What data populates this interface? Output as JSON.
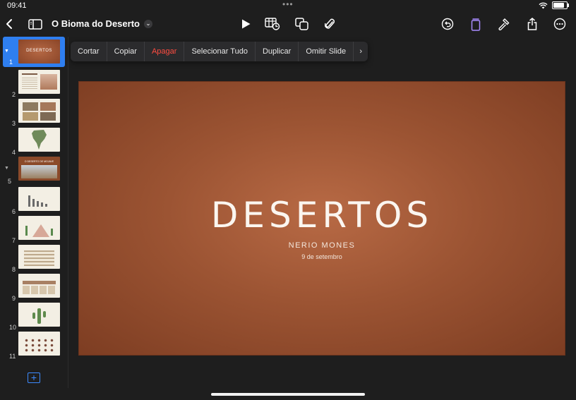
{
  "status": {
    "time": "09:41"
  },
  "toolbar": {
    "title": "O Bioma do Deserto"
  },
  "context_menu": {
    "items": [
      "Cortar",
      "Copiar",
      "Apagar",
      "Selecionar Tudo",
      "Duplicar",
      "Omitir Slide"
    ]
  },
  "slides": {
    "numbers": [
      "1",
      "2",
      "3",
      "4",
      "5",
      "6",
      "7",
      "8",
      "9",
      "10",
      "11"
    ],
    "selected": 1,
    "thumb1_title": "DESERTOS",
    "thumb5_title": "O DESERTO DE MOJAVE"
  },
  "current_slide": {
    "title": "DESERTOS",
    "author": "NERIO MONES",
    "date": "9 de setembro"
  },
  "colors": {
    "accent": "#2f7ff0",
    "danger": "#ff4c41",
    "slide_bg": "#9c5433"
  }
}
